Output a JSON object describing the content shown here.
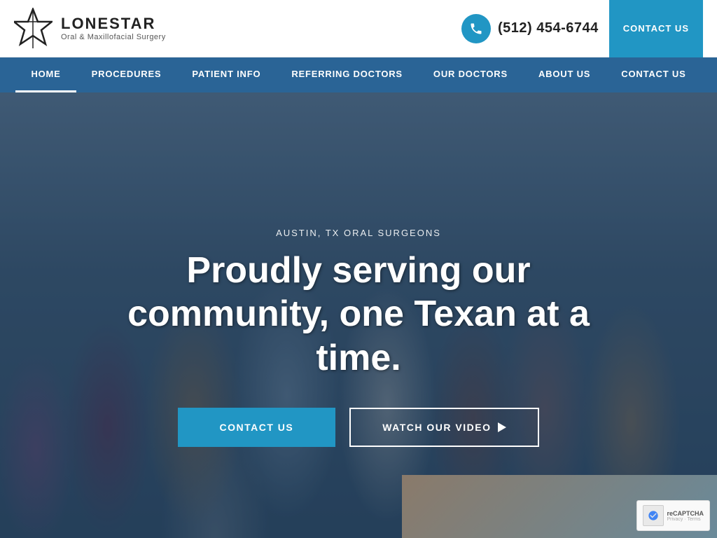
{
  "brand": {
    "name": "LoneStar",
    "tagline": "Oral & Maxillofacial Surgery",
    "star_unicode": "★"
  },
  "header": {
    "phone": "(512) 454-6744",
    "contact_btn": "CONT..."
  },
  "nav": {
    "items": [
      {
        "label": "HOME",
        "active": true
      },
      {
        "label": "PROCEDURES",
        "active": false
      },
      {
        "label": "PATIENT INFO",
        "active": false
      },
      {
        "label": "REFERRING DOCTORS",
        "active": false
      },
      {
        "label": "OUR DOCTORS",
        "active": false
      },
      {
        "label": "ABOUT US",
        "active": false
      },
      {
        "label": "CONTACT US",
        "active": false
      }
    ]
  },
  "hero": {
    "subtitle": "AUSTIN, TX ORAL SURGEONS",
    "title": "Proudly serving our community, one Texan at a time.",
    "contact_btn": "CONTACT US",
    "video_btn": "WATCH OUR VIDEO"
  },
  "recaptcha": {
    "text": "reCAPTCHA",
    "subtext": "Privacy · Terms"
  }
}
